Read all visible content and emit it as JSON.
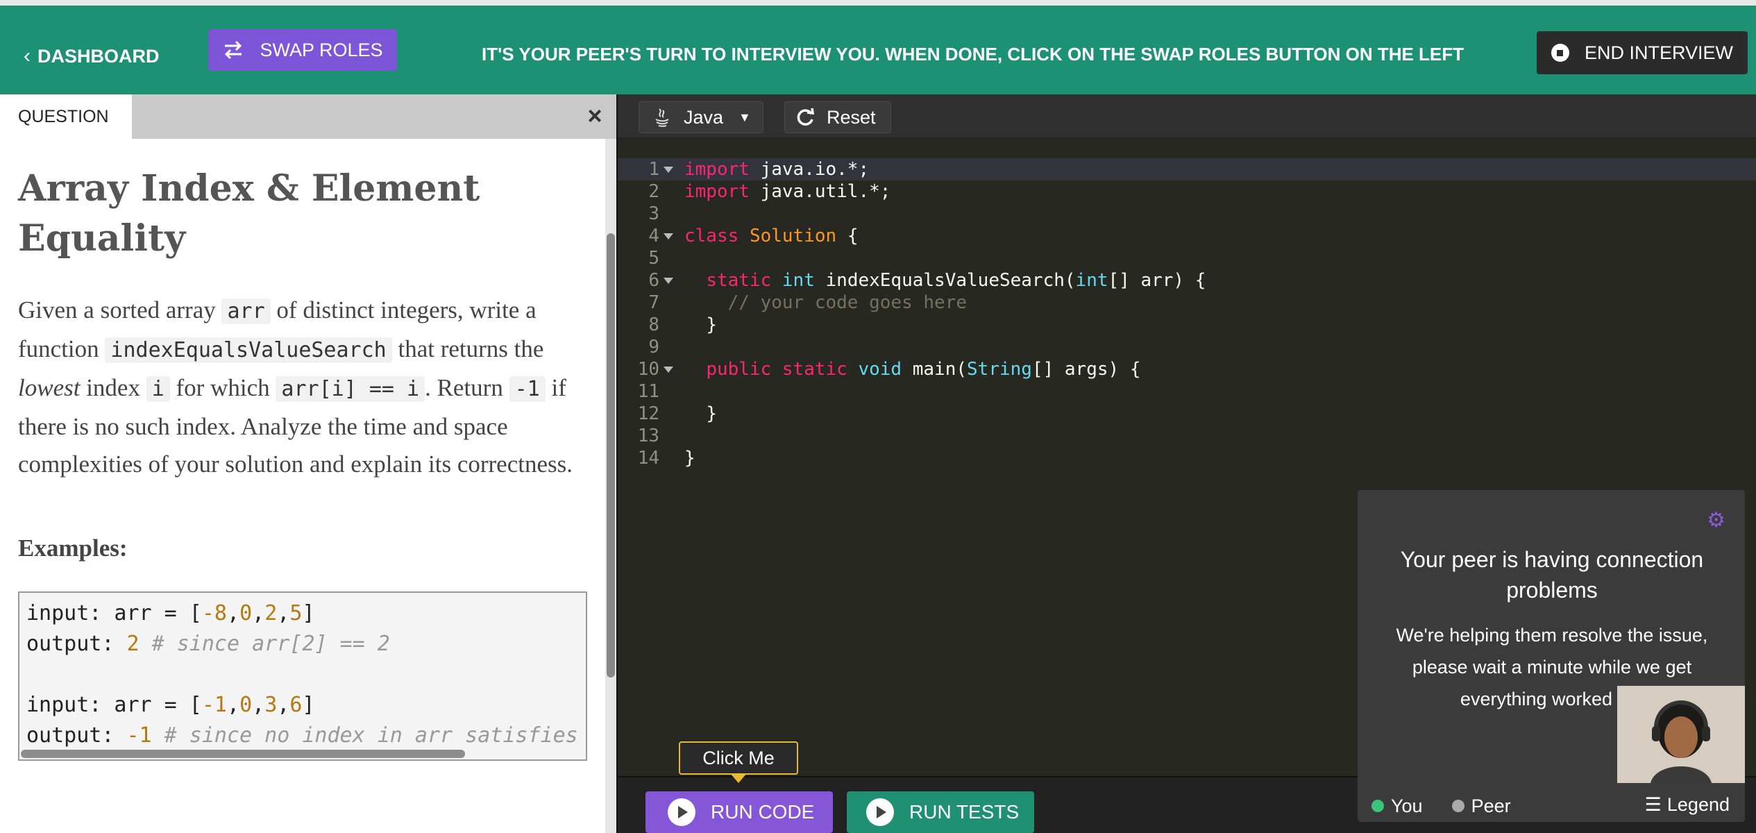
{
  "header": {
    "dashboard_label": "DASHBOARD",
    "swap_roles_label": "SWAP ROLES",
    "banner_text": "IT'S YOUR PEER'S TURN TO INTERVIEW YOU. WHEN DONE, CLICK ON THE SWAP ROLES BUTTON ON THE LEFT",
    "end_interview_label": "END INTERVIEW",
    "accent_color": "#1c9174",
    "swap_color": "#7d55d9"
  },
  "question": {
    "tab_label": "QUESTION",
    "close_glyph": "×",
    "title": "Array Index & Element Equality",
    "desc": {
      "p1": "Given a sorted array ",
      "c1": "arr",
      "p2": " of distinct integers, write a function ",
      "c2": "indexEqualsValueSearch",
      "p3": " that returns the ",
      "em": "lowest",
      "p4": " index ",
      "c3": "i",
      "p5": " for which ",
      "c4": "arr[i] == i",
      "p6": ". Return ",
      "c5": "-1",
      "p7": " if there is no such index. Analyze the time and space complexities of your solution and explain its correctness."
    },
    "examples_heading": "Examples:",
    "examples": [
      {
        "input_kw": "input: arr = [",
        "n1": "-8",
        "n2": "0",
        "n3": "2",
        "n4": "5",
        "close": "]",
        "output_kw": "output: ",
        "out": "2",
        "comment": " # since arr[2] == 2"
      },
      {
        "input_kw": "input: arr = [",
        "n1": "-1",
        "n2": "0",
        "n3": "3",
        "n4": "6",
        "close": "]",
        "output_kw": "output: ",
        "out": "-1",
        "comment": " # since no index in arr satisfies"
      }
    ]
  },
  "editor": {
    "language": "Java",
    "reset_label": "Reset",
    "lines": [
      "1",
      "2",
      "3",
      "4",
      "5",
      "6",
      "7",
      "8",
      "9",
      "10",
      "11",
      "12",
      "13",
      "14"
    ],
    "code": {
      "l1_kw": "import",
      "l1_rest": " java.io.*;",
      "l2_kw": "import",
      "l2_rest": " java.util.*;",
      "l4_kw": "class",
      "l4_cls": "Solution",
      "l4_rest": " {",
      "l6_kw": "static",
      "l6_ty": "int",
      "l6_name": " indexEqualsValueSearch(",
      "l6_ty2": "int",
      "l6_rest": "[] arr) {",
      "l7_cm": "// your code goes here",
      "l8": "}",
      "l10_kw1": "public",
      "l10_kw2": "static",
      "l10_ty": "void",
      "l10_name": " main(",
      "l10_ty2": "String",
      "l10_rest": "[] args) {",
      "l12": "}",
      "l14": "}"
    }
  },
  "bottom": {
    "tooltip": "Click Me",
    "run_code_label": "RUN CODE",
    "run_tests_label": "RUN TESTS"
  },
  "video": {
    "gear_icon": "gear-icon",
    "title": "Your peer is having connection problems",
    "message": "We're helping them resolve the issue, please wait a minute while we get everything worked out",
    "you_label": "You",
    "peer_label": "Peer",
    "legend_label": "Legend",
    "you_color": "#3cc47c",
    "peer_color": "#aaaaaa"
  }
}
